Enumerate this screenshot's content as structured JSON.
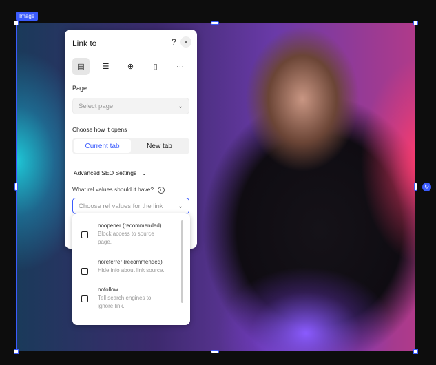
{
  "canvas": {
    "element_label": "Image",
    "accent": "#3b5bfd"
  },
  "panel": {
    "title": "Link to",
    "help": "?",
    "close": "×",
    "link_types": [
      {
        "icon": "page-icon",
        "selected": true
      },
      {
        "icon": "section-icon"
      },
      {
        "icon": "web-globe-icon"
      },
      {
        "icon": "document-icon"
      },
      {
        "icon": "more-icon"
      }
    ],
    "page_label": "Page",
    "page_placeholder": "Select page",
    "open_label": "Choose how it opens",
    "open_options": [
      "Current tab",
      "New tab"
    ],
    "open_selected": "Current tab",
    "seo_label": "Advanced SEO Settings",
    "rel_label": "What rel values should it have?",
    "rel_placeholder": "Choose rel values for the link"
  },
  "rel_options": [
    {
      "name": "noopener (recommended)",
      "desc": "Block access to source page.",
      "checked": false
    },
    {
      "name": "noreferrer (recommended)",
      "desc": "Hide info about link source.",
      "checked": false
    },
    {
      "name": "nofollow",
      "desc": "Tell search engines to ignore link.",
      "checked": false
    }
  ]
}
